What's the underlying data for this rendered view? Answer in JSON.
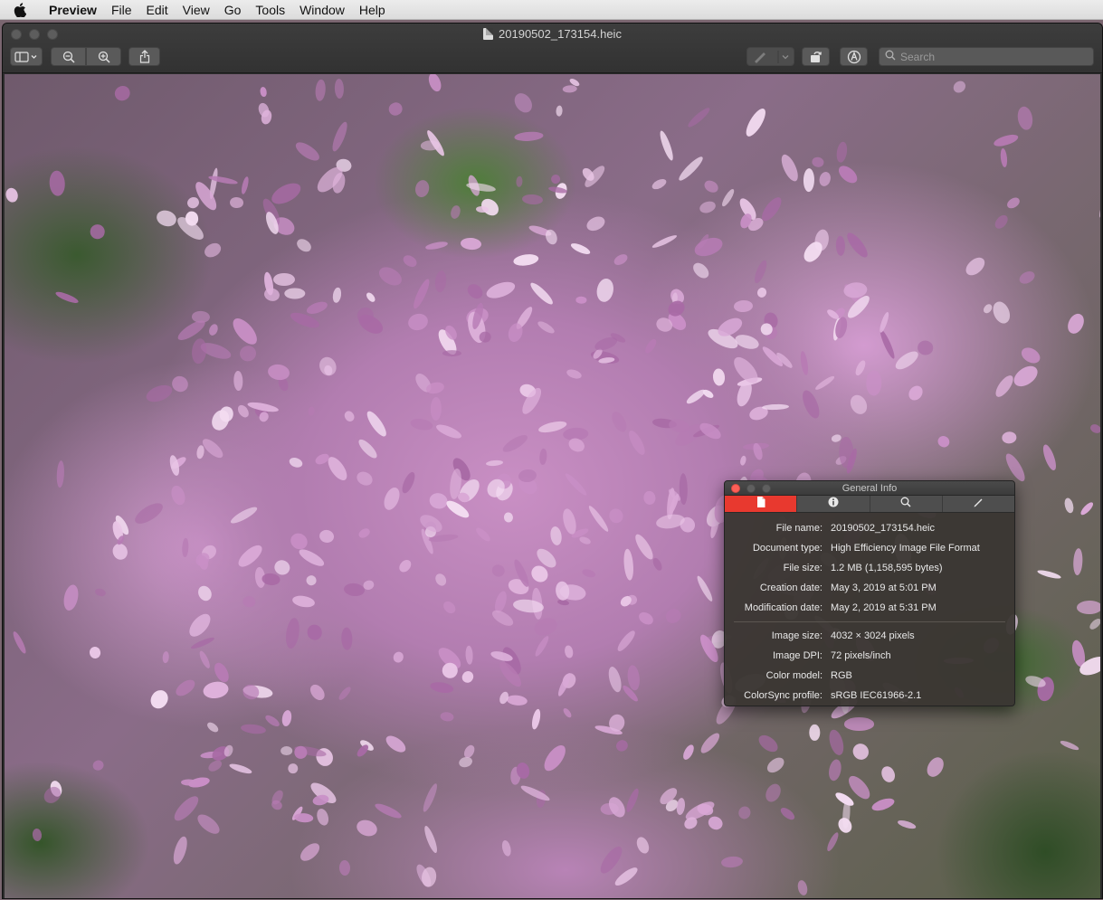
{
  "menubar": {
    "app_name": "Preview",
    "items": [
      "File",
      "Edit",
      "View",
      "Go",
      "Tools",
      "Window",
      "Help"
    ]
  },
  "window": {
    "title": "20190502_173154.heic"
  },
  "toolbar": {
    "search_placeholder": "Search",
    "buttons": [
      "sidebar-icon",
      "zoom-out-icon",
      "zoom-in-icon",
      "share-icon",
      "markup-pen-icon",
      "rotate-icon",
      "markup-toolbar-icon"
    ]
  },
  "info_panel": {
    "title": "General Info",
    "tabs": [
      "document-icon",
      "info-icon",
      "magnifier-icon",
      "pencil-icon"
    ],
    "rows_general": [
      {
        "label": "File name:",
        "value": "20190502_173154.heic"
      },
      {
        "label": "Document type:",
        "value": "High Efficiency Image File Format"
      },
      {
        "label": "File size:",
        "value": "1.2 MB (1,158,595 bytes)"
      },
      {
        "label": "Creation date:",
        "value": "May 3, 2019 at 5:01 PM"
      },
      {
        "label": "Modification date:",
        "value": "May 2, 2019 at 5:31 PM"
      }
    ],
    "rows_image": [
      {
        "label": "Image size:",
        "value": "4032 × 3024 pixels"
      },
      {
        "label": "Image DPI:",
        "value": "72 pixels/inch"
      },
      {
        "label": "Color model:",
        "value": "RGB"
      },
      {
        "label": "ColorSync profile:",
        "value": "sRGB IEC61966-2.1"
      }
    ]
  },
  "colors": {
    "active_tab": "#e8392f",
    "window_chrome": "#323232"
  }
}
